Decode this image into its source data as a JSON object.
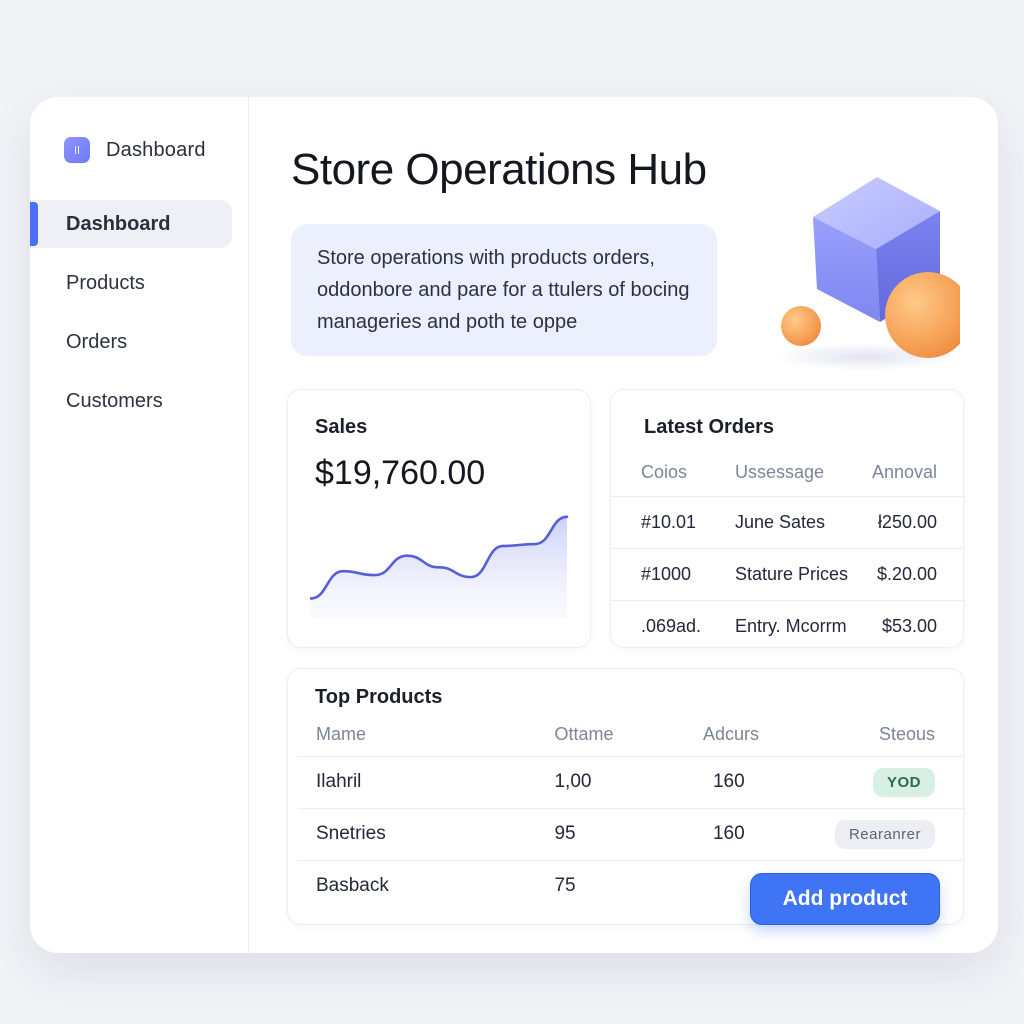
{
  "app": {
    "brand": "Dashboard"
  },
  "sidebar": {
    "items": [
      {
        "label": "Dashboard",
        "active": true
      },
      {
        "label": "Products",
        "active": false
      },
      {
        "label": "Orders",
        "active": false
      },
      {
        "label": "Customers",
        "active": false
      }
    ]
  },
  "main": {
    "title": "Store Operations Hub",
    "description": "Store operations with products orders, oddonbore and pare for a ttulers of bocing manageries and poth te oppe"
  },
  "sales": {
    "title": "Sales",
    "value": "$19,760.00",
    "sparkline": [
      8,
      22,
      20,
      30,
      24,
      19,
      35,
      36,
      50
    ]
  },
  "latest_orders": {
    "title": "Latest Orders",
    "columns": [
      "Coios",
      "Ussessage",
      "Annoval"
    ],
    "rows": [
      [
        "#10.01",
        "June Sates",
        "ł250.00"
      ],
      [
        "#1000",
        "Stature Prices",
        "$.20.00"
      ],
      [
        ".069ad.",
        "Entry. Mcorrm",
        "$53.00"
      ]
    ]
  },
  "top_products": {
    "title": "Top Products",
    "columns": [
      "Mame",
      "Ottame",
      "Adcurs",
      "Steous"
    ],
    "rows": [
      {
        "name": "Ilahril",
        "qty": "1,00",
        "adcurs": "160",
        "status": "YOD",
        "status_kind": "ok"
      },
      {
        "name": "Snetries",
        "qty": "95",
        "adcurs": "160",
        "status": "Rearanrer",
        "status_kind": "muted"
      },
      {
        "name": "Basback",
        "qty": "75",
        "adcurs": "",
        "status": "",
        "status_kind": ""
      }
    ]
  },
  "actions": {
    "add_product": "Add product"
  },
  "colors": {
    "accent": "#3f74f4",
    "sidebar_indicator": "#4f6df5",
    "chart_line": "#5560d8"
  }
}
